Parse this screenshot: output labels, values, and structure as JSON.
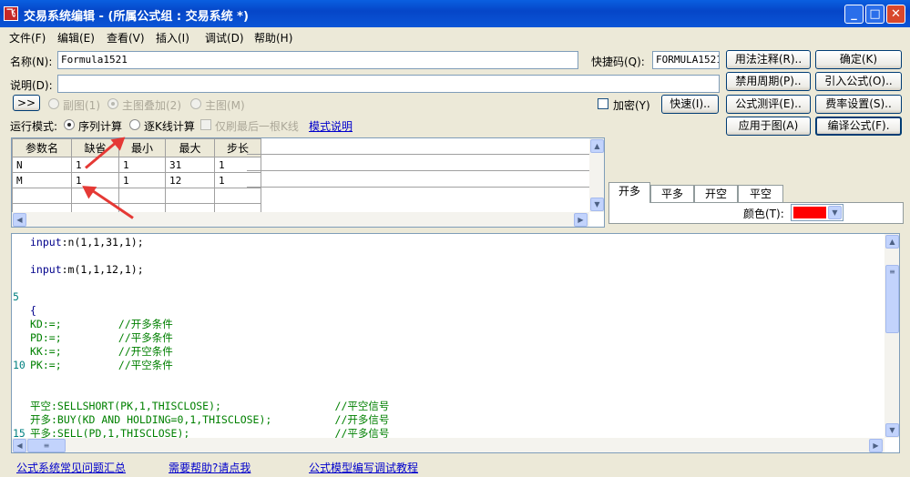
{
  "window": {
    "icon_text": "飞",
    "title": "交易系统编辑 - (所属公式组 : 交易系统 *)",
    "controls": {
      "minimize": "_",
      "maximize": "□",
      "close": "✕"
    }
  },
  "menu": [
    "文件(F)",
    "编辑(E)",
    "查看(V)",
    "插入(I)",
    "调试(D)",
    "帮助(H)"
  ],
  "form": {
    "name_label": "名称(N):",
    "name_value": "Formula1521",
    "shortcut_label": "快捷码(Q):",
    "shortcut_value": "FORMULA1521",
    "desc_label": "说明(D):",
    "desc_value": "",
    "expand_button": ">>",
    "chart_options": [
      "副图(1)",
      "主图叠加(2)",
      "主图(M)"
    ],
    "encrypt_label": "加密(Y)",
    "fast_button": "快速(I)..",
    "run_mode_label": "运行模式:",
    "run_modes": [
      "序列计算",
      "逐K线计算"
    ],
    "refresh_last_label": "仅刷最后一根K线",
    "mode_help_link": "模式说明"
  },
  "buttons": {
    "usage_note": "用法注释(R)..",
    "confirm": "确定(K)",
    "disable_period": "禁用周期(P)..",
    "import_formula": "引入公式(O)..",
    "formula_test": "公式测评(E)..",
    "fee_settings": "费率设置(S)..",
    "apply_chart": "应用于图(A)",
    "compile": "编译公式(F)."
  },
  "params": {
    "headers": [
      "参数名",
      "缺省",
      "最小",
      "最大",
      "步长"
    ],
    "rows": [
      [
        "N",
        "1",
        "1",
        "31",
        "1"
      ],
      [
        "M",
        "1",
        "1",
        "12",
        "1"
      ],
      [
        "",
        "",
        "",
        "",
        ""
      ],
      [
        "",
        "",
        "",
        "",
        ""
      ]
    ]
  },
  "signal_tabs": [
    "开多",
    "平多",
    "开空",
    "平空"
  ],
  "color_label": "颜色(T):",
  "color_value": "#FF0000",
  "code_lines": [
    {
      "n": "",
      "parts": [
        [
          "c-blue",
          "input"
        ],
        [
          "c-black",
          ":n(1,1,31,1);"
        ]
      ]
    },
    {
      "n": "",
      "parts": []
    },
    {
      "n": "",
      "parts": [
        [
          "c-blue",
          "input"
        ],
        [
          "c-black",
          ":m(1,1,12,1);"
        ]
      ]
    },
    {
      "n": "",
      "parts": []
    },
    {
      "n": "5",
      "parts": []
    },
    {
      "n": "",
      "parts": [
        [
          "c-blue",
          "{"
        ]
      ]
    },
    {
      "n": "",
      "parts": [
        [
          "c-green",
          "KD:=;         //开多条件"
        ]
      ]
    },
    {
      "n": "",
      "parts": [
        [
          "c-green",
          "PD:=;         //平多条件"
        ]
      ]
    },
    {
      "n": "",
      "parts": [
        [
          "c-green",
          "KK:=;         //开空条件"
        ]
      ]
    },
    {
      "n": "10",
      "parts": [
        [
          "c-green",
          "PK:=;         //平空条件"
        ]
      ]
    },
    {
      "n": "",
      "parts": []
    },
    {
      "n": "",
      "parts": []
    },
    {
      "n": "",
      "parts": [
        [
          "c-green",
          "平空:SELLSHORT(PK,1,THISCLOSE);                  //平空信号"
        ]
      ]
    },
    {
      "n": "",
      "parts": [
        [
          "c-green",
          "开多:BUY(KD AND HOLDING=0,1,THISCLOSE);          //开多信号"
        ]
      ]
    },
    {
      "n": "15",
      "parts": [
        [
          "c-green",
          "平多:SELL(PD,1,THISCLOSE);                       //平多信号"
        ]
      ]
    }
  ],
  "footer_links": [
    "公式系统常见问题汇总",
    "需要帮助?请点我",
    "公式模型编写调试教程"
  ]
}
